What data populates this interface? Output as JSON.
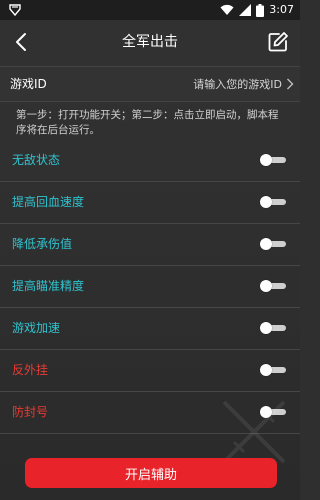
{
  "status_bar": {
    "time": "3:07",
    "icons": [
      "app-notification-icon",
      "wifi-icon",
      "cellular-signal-icon",
      "battery-icon"
    ]
  },
  "header": {
    "title": "全军出击",
    "back_icon": "back-arrow-icon",
    "edit_icon": "edit-icon"
  },
  "game_id": {
    "label": "游戏ID",
    "placeholder": "请输入您的游戏ID",
    "value": ""
  },
  "instructions": "第一步：打开功能开关；第二步：点击立即启动，脚本程序将在后台运行。",
  "features": [
    {
      "label": "无敌状态",
      "color": "#2fc3cf",
      "enabled": false
    },
    {
      "label": "提高回血速度",
      "color": "#2fc3cf",
      "enabled": false
    },
    {
      "label": "降低承伤值",
      "color": "#2fc3cf",
      "enabled": false
    },
    {
      "label": "提高瞄准精度",
      "color": "#2fc3cf",
      "enabled": false
    },
    {
      "label": "游戏加速",
      "color": "#2fc3cf",
      "enabled": false
    },
    {
      "label": "反外挂",
      "color": "#e83a34",
      "enabled": false
    },
    {
      "label": "防封号",
      "color": "#e83a34",
      "enabled": false
    }
  ],
  "start_button": {
    "label": "开启辅助",
    "color": "#e8232a"
  }
}
